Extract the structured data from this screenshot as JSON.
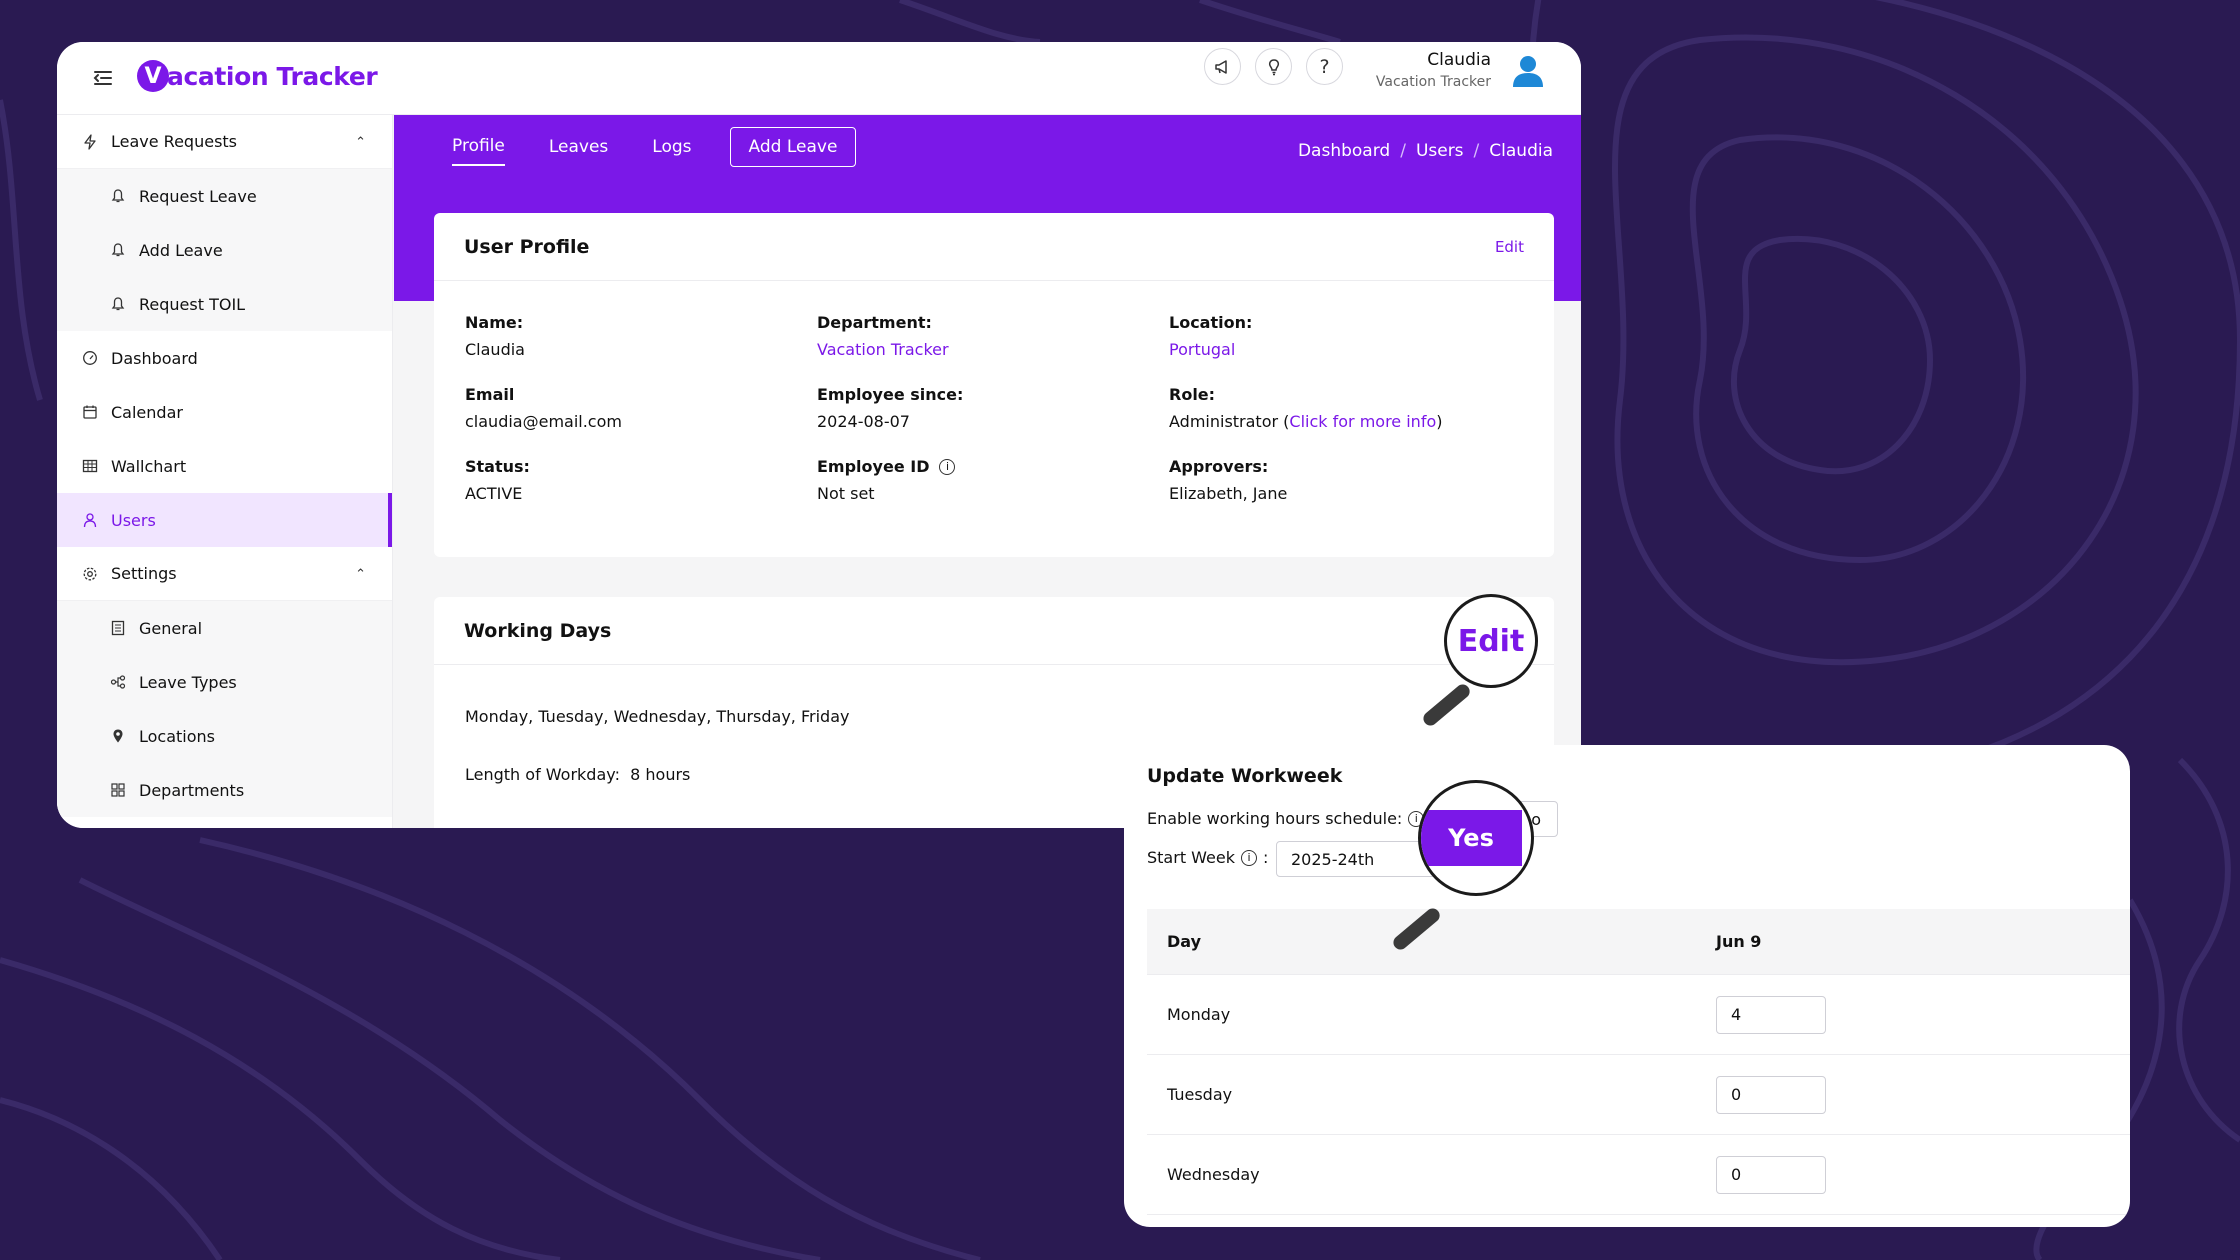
{
  "app": {
    "logo_letter": "V",
    "logo_text": "acation Tracker"
  },
  "topbar": {
    "icons": [
      "megaphone-icon",
      "lightbulb-icon",
      "help-icon"
    ],
    "user_name": "Claudia",
    "user_org": "Vacation Tracker"
  },
  "sidebar": {
    "items": [
      {
        "label": "Leave Requests",
        "icon": "bolt-icon",
        "type": "group"
      },
      {
        "label": "Request Leave",
        "icon": "bell-icon",
        "type": "sub"
      },
      {
        "label": "Add Leave",
        "icon": "bell-icon",
        "type": "sub"
      },
      {
        "label": "Request TOIL",
        "icon": "bell-icon",
        "type": "sub"
      },
      {
        "label": "Dashboard",
        "icon": "gauge-icon",
        "type": "item"
      },
      {
        "label": "Calendar",
        "icon": "calendar-icon",
        "type": "item"
      },
      {
        "label": "Wallchart",
        "icon": "table-icon",
        "type": "item"
      },
      {
        "label": "Users",
        "icon": "user-icon",
        "type": "active"
      },
      {
        "label": "Settings",
        "icon": "gear-icon",
        "type": "group"
      },
      {
        "label": "General",
        "icon": "list-icon",
        "type": "sub"
      },
      {
        "label": "Leave Types",
        "icon": "nodes-icon",
        "type": "sub"
      },
      {
        "label": "Locations",
        "icon": "pin-icon",
        "type": "sub"
      },
      {
        "label": "Departments",
        "icon": "grid-icon",
        "type": "sub"
      }
    ]
  },
  "tabs": {
    "profile": "Profile",
    "leaves": "Leaves",
    "logs": "Logs",
    "add_leave": "Add Leave"
  },
  "breadcrumb": {
    "a": "Dashboard",
    "b": "Users",
    "c": "Claudia",
    "sep": "/"
  },
  "profile": {
    "title": "User Profile",
    "edit": "Edit",
    "name_label": "Name:",
    "name": "Claudia",
    "dept_label": "Department:",
    "dept": "Vacation Tracker",
    "loc_label": "Location:",
    "loc": "Portugal",
    "email_label": "Email",
    "email": "claudia@email.com",
    "since_label": "Employee since:",
    "since": "2024-08-07",
    "role_label": "Role:",
    "role_prefix": "Administrator (",
    "role_link": "Click for more info",
    "role_suffix": ")",
    "status_label": "Status:",
    "status": "ACTIVE",
    "empid_label": "Employee ID",
    "empid": "Not set",
    "approvers_label": "Approvers:",
    "approvers": "Elizabeth, Jane"
  },
  "working_days": {
    "title": "Working Days",
    "days": "Monday, Tuesday, Wednesday, Thursday, Friday",
    "length_label": "Length of Workday:",
    "length": "8 hours",
    "magnifier_text": "Edit"
  },
  "workweek": {
    "title": "Update Workweek",
    "enable_label": "Enable working hours schedule:",
    "start_label": "Start Week",
    "start_colon": ":",
    "start_value": "2025-24th",
    "magnifier_text": "Yes",
    "partial_text": "o",
    "col_day": "Day",
    "col_date": "Jun 9",
    "rows": [
      {
        "day": "Monday",
        "value": "4"
      },
      {
        "day": "Tuesday",
        "value": "0"
      },
      {
        "day": "Wednesday",
        "value": "0"
      }
    ]
  },
  "colors": {
    "brand": "#7b18e8",
    "background": "#2a1a52",
    "avatar": "#1e88d6"
  }
}
